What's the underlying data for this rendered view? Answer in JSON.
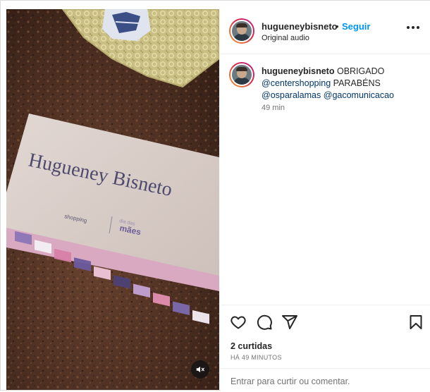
{
  "post": {
    "author": {
      "username": "hugueneybisneto",
      "separator": "•",
      "follow_label": "Seguir",
      "audio_label": "Original audio"
    },
    "media": {
      "box_text": "Hugueney Bisneto",
      "logo_left": "shopping",
      "logo_right_top": "dia das",
      "logo_right_main": "mães"
    },
    "caption": {
      "username": "hugueneybisneto",
      "text_start": "OBRIGADO",
      "mention_1": "@centershopping",
      "text_mid": "PARABÉNS",
      "mention_2": "@osparalamas",
      "mention_3": "@gacomunicacao",
      "time": "49 min"
    },
    "stats": {
      "likes": "2 curtidas",
      "timestamp": "HÁ 49 MINUTOS"
    },
    "comment_box": {
      "placeholder": "Entrar para curtir ou comentar."
    },
    "icons": {
      "like": "heart-icon",
      "comment": "comment-icon",
      "share": "share-icon",
      "save": "bookmark-icon",
      "more": "more-icon",
      "mute": "speaker-muted-icon"
    },
    "colors": {
      "link": "#0095f6",
      "mention": "#00376b",
      "text": "#262626",
      "secondary": "#737373"
    }
  }
}
